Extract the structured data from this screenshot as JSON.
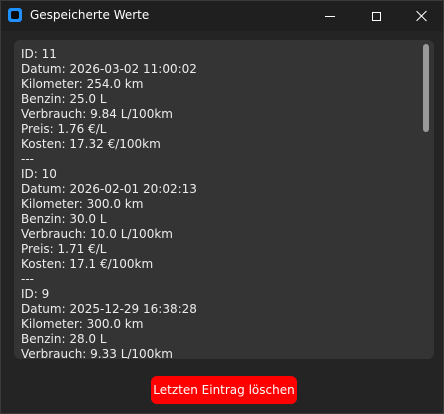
{
  "window": {
    "title": "Gespeicherte Werte"
  },
  "icons": {
    "app": "app-icon",
    "minimize": "minimize-icon",
    "maximize": "maximize-icon",
    "close": "close-icon"
  },
  "colors": {
    "accent_button": "#ff0000",
    "panel_bg": "#343434",
    "window_bg": "#242424"
  },
  "entries": [
    [
      "ID: 11",
      "Datum: 2026-03-02 11:00:02",
      "Kilometer: 254.0 km",
      "Benzin: 25.0 L",
      "Verbrauch: 9.84 L/100km",
      "Preis: 1.76 €/L",
      "Kosten: 17.32 €/100km",
      "---"
    ],
    [
      "ID: 10",
      "Datum: 2026-02-01 20:02:13",
      "Kilometer: 300.0 km",
      "Benzin: 30.0 L",
      "Verbrauch: 10.0 L/100km",
      "Preis: 1.71 €/L",
      "Kosten: 17.1 €/100km",
      "---"
    ],
    [
      "ID: 9",
      "Datum: 2025-12-29 16:38:28",
      "Kilometer: 300.0 km",
      "Benzin: 28.0 L",
      "Verbrauch: 9.33 L/100km"
    ]
  ],
  "actions": {
    "delete_last_label": "Letzten Eintrag löschen"
  }
}
